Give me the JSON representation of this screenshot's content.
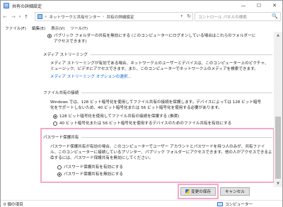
{
  "window": {
    "title": "共有の詳細設定",
    "minimize": "—",
    "maximize": "☐",
    "close": "✕"
  },
  "address": {
    "back": "←",
    "forward": "→",
    "recent": "▾",
    "up": "↑",
    "crumb_sep_1": "«",
    "crumb_1": "ネットワークと共有センター",
    "crumb_sep_2": "›",
    "crumb_2": "共有の詳細設定",
    "dropdown": "▾",
    "refresh": "↻",
    "search_placeholder": "コントロール パネルの検索",
    "search_icon": "🔍"
  },
  "menu": [
    "ファイル(F)",
    "編集(E)",
    "表示(V)",
    "ツール(T)"
  ],
  "public_folder": {
    "option_off_line1": "パブリック フォルダーの共有を無効にする (このコンピューターにログオンしている場合はこれらのフォルダーに",
    "option_off_line2": "アクセスできます)"
  },
  "media": {
    "header": "メディア ストリーミング",
    "desc_line1": "メディア ストリーミングが有効である場合、ネットワーク上のユーザーとデバイスは、このコンピューター上のピクチャ、",
    "desc_line2": "ミュージック、ビデオにアクセスできます。また、このコンピューターでネットワーク上のメディアを検索できます。",
    "link": "メディア ストリーミング オプションの選択..."
  },
  "file_sharing": {
    "header": "ファイル共有の接続",
    "desc_line1": "Windows では、128 ビット暗号化を使用してファイル共有の接続を保護します。デバイスによっては 128 ビット暗号",
    "desc_line2": "化をサポートしないため、40 ビット暗号化または 56 ビット暗号化を使用する必要があります。",
    "option_128": "128 ビット暗号化を使用してファイル共有の接続を保護する (推奨)",
    "option_40": "40 ビット暗号化または 56 ビット暗号化を使用するデバイスのためのファイル共有を有効にする"
  },
  "password": {
    "header": "パスワード保護共有",
    "desc_line1": "パスワード保護共有が有効の場合、このコンピューターでユーザー アカウントとパスワードを持つ人のみが、共有ファイ",
    "desc_line2": "ル、このコンピューターに接続しているプリンター、パブリック フォルダーにアクセスできます。他の人がアクセスできるよう",
    "desc_line3": "にするには、パスワード保護共有を無効にしてください。",
    "option_on": "パスワード保護共有を有効にする",
    "option_off": "パスワード保護共有を無効にする"
  },
  "buttons": {
    "save": "変更の保存",
    "cancel": "キャンセル"
  },
  "status": {
    "items": "0 個の項目",
    "location": "コンピューター"
  },
  "scrollbar": {
    "up": "▲",
    "down": "▼"
  },
  "colors": {
    "highlight": "#f5a9c9",
    "link": "#0066cc"
  }
}
